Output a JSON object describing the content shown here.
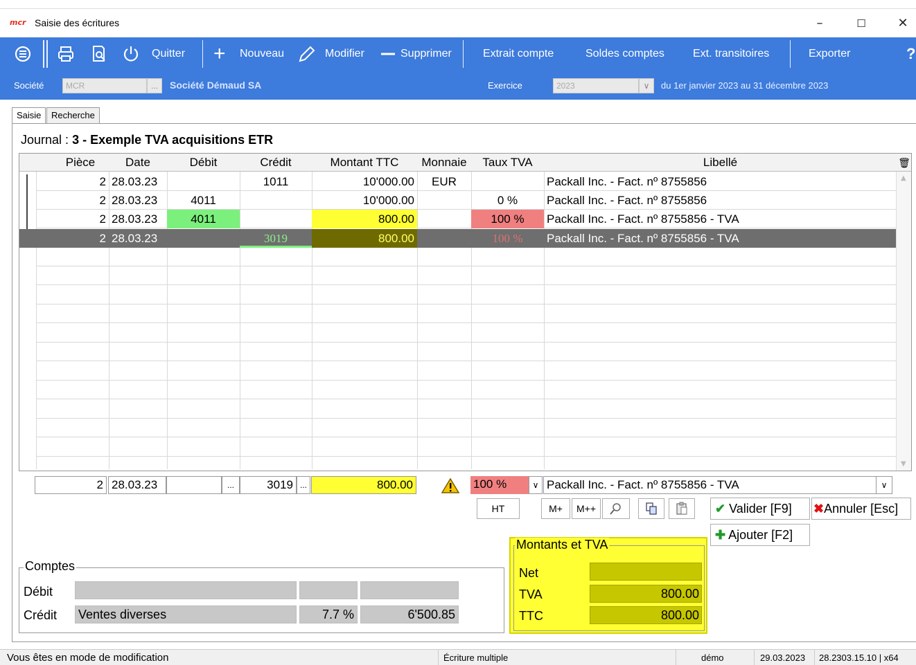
{
  "window": {
    "title": "Saisie des écritures",
    "logo": "mcr"
  },
  "toolbar": {
    "quit": "Quitter",
    "new": "Nouveau",
    "edit": "Modifier",
    "delete": "Supprimer",
    "extract": "Extrait compte",
    "balances": "Soldes comptes",
    "transit": "Ext. transitoires",
    "export": "Exporter",
    "help": "?"
  },
  "company": {
    "label": "Société",
    "code": "MCR",
    "name": "Société Démaud SA",
    "year_label": "Exercice",
    "year": "2023",
    "period": "du 1er janvier 2023 au 31 décembre 2023"
  },
  "tabs": [
    {
      "label": "Saisie"
    },
    {
      "label": "Recherche"
    }
  ],
  "journal": {
    "prefix": "Journal :",
    "number": "3",
    "name": "Exemple TVA acquisitions ETR"
  },
  "grid": {
    "headers": [
      "Pièce",
      "Date",
      "Débit",
      "Crédit",
      "Montant TTC",
      "Monnaie",
      "Taux TVA",
      "Libellé"
    ],
    "rows": [
      {
        "piece": "2",
        "date": "28.03.23",
        "debit": "",
        "credit": "1011",
        "amount": "10'000.00",
        "currency": "EUR",
        "vat": "",
        "label": "Packall Inc. - Fact. nº 8755856"
      },
      {
        "piece": "2",
        "date": "28.03.23",
        "debit": "4011",
        "credit": "",
        "amount": "10'000.00",
        "currency": "",
        "vat": "0 %",
        "label": "Packall Inc. - Fact. nº 8755856"
      },
      {
        "piece": "2",
        "date": "28.03.23",
        "debit": "4011",
        "credit": "",
        "amount": "800.00",
        "currency": "",
        "vat": "100 %",
        "label": "Packall Inc. - Fact. nº 8755856 - TVA"
      },
      {
        "piece": "2",
        "date": "28.03.23",
        "debit": "",
        "credit": "3019",
        "amount": "800.00",
        "currency": "",
        "vat": "100 %",
        "label": "Packall Inc. - Fact. nº 8755856 - TVA"
      }
    ]
  },
  "edit": {
    "piece": "2",
    "date": "28.03.23",
    "ellipsis": "...",
    "credit": "3019",
    "amount": "800.00",
    "vat": "100 %",
    "label": "Packall Inc. - Fact. nº 8755856 - TVA"
  },
  "buttons": {
    "ht": "HT",
    "mplus": "M+",
    "mplusplus": "M++",
    "validate": "Valider [F9]",
    "cancel": "Annuler [Esc]",
    "add": "Ajouter [F2]"
  },
  "accounts": {
    "title": "Comptes",
    "debit_label": "Débit",
    "credit_label": "Crédit",
    "credit_name": "Ventes diverses",
    "credit_rate": "7.7 %",
    "credit_balance": "6'500.85"
  },
  "vat_box": {
    "title": "Montants et TVA",
    "net_label": "Net",
    "net": "",
    "vat_label": "TVA",
    "vat": "800.00",
    "ttc_label": "TTC",
    "ttc": "800.00"
  },
  "status": {
    "mode": "Vous êtes en mode de modification",
    "entry": "Écriture multiple",
    "user": "démo",
    "date": "29.03.2023",
    "version": "28.2303.15.10 | x64"
  },
  "colors": {
    "accent": "#3d7bdc",
    "green": "#7cf07c",
    "yellow": "#ffff33",
    "red": "#f08080",
    "selected": "#6e6e6e"
  }
}
